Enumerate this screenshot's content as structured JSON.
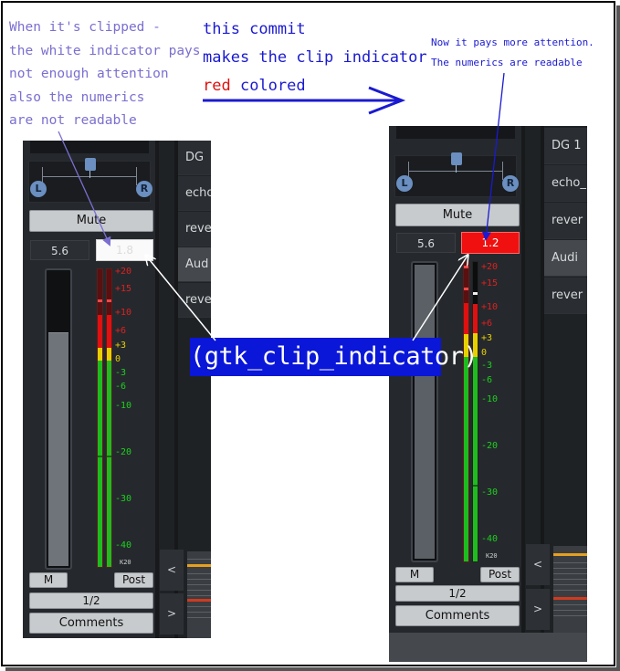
{
  "annotations": {
    "left_note": [
      "When it's clipped -",
      "the white indicator pays",
      "not enough attention",
      "also the numerics",
      "are not readable"
    ],
    "center_note": {
      "line1": "this commit",
      "line2": "makes the clip indicator",
      "line3_red": "red",
      "line3_rest": " colored"
    },
    "right_note": [
      "Now it pays more attention.",
      "The numerics are readable"
    ],
    "clip_label": "(gtk_clip_indicator)"
  },
  "colors": {
    "annotation_blue": "#1a1ad0",
    "annotation_lavender": "#7a6fd0",
    "label_bg": "#0a16d8",
    "clip_old": "#fafafa",
    "clip_new": "#f01010"
  },
  "left_strip": {
    "pan_left": "L",
    "pan_right": "R",
    "mute_label": "Mute",
    "gain_value": "5.6",
    "peak_value": "1.8",
    "meter_ticks": [
      "+20",
      "+15",
      "+10",
      "+6",
      "+3",
      "0",
      "-3",
      "-6",
      "-10",
      "-20",
      "-30",
      "-40"
    ],
    "meter_scale": "K20",
    "m_label": "M",
    "post_label": "Post",
    "input_label": "1/2",
    "comments_label": "Comments",
    "track_names": [
      "DG",
      "echo",
      "reve",
      "Aud",
      "reve"
    ],
    "nav_left": "<",
    "nav_right": ">"
  },
  "right_strip": {
    "pan_left": "L",
    "pan_right": "R",
    "mute_label": "Mute",
    "gain_value": "5.6",
    "peak_value": "1.2",
    "meter_ticks": [
      "+20",
      "+15",
      "+10",
      "+6",
      "+3",
      "0",
      "-3",
      "-6",
      "-10",
      "-20",
      "-30",
      "-40"
    ],
    "meter_scale": "K20",
    "m_label": "M",
    "post_label": "Post",
    "input_label": "1/2",
    "comments_label": "Comments",
    "track_names": [
      "DG 1",
      "echo_",
      "rever",
      "Audi",
      "rever"
    ],
    "nav_left": "<",
    "nav_right": ">"
  }
}
